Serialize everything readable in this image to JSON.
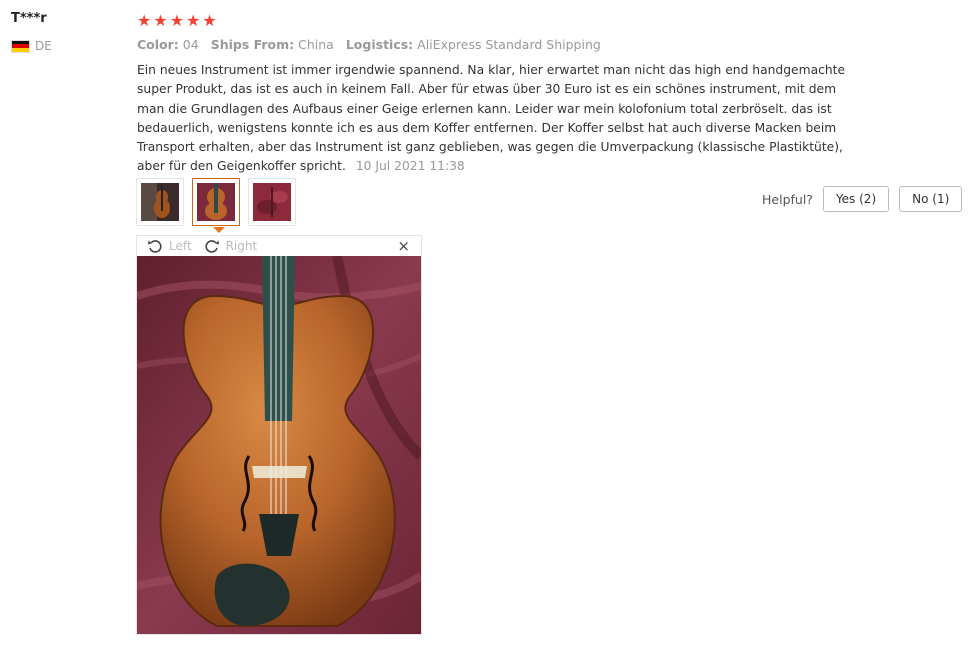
{
  "review": {
    "user": "T***r",
    "country": "DE",
    "rating": 5,
    "color_key": "Color:",
    "color_val": "04",
    "ships_key": "Ships From:",
    "ships_val": "China",
    "logistics_key": "Logistics:",
    "logistics_val": "AliExpress Standard Shipping",
    "text": "Ein neues Instrument ist immer irgendwie spannend. Na klar, hier erwartet man nicht das high end handgemachte super Produkt, das ist es auch in keinem Fall. Aber für etwas über 30 Euro ist es ein schönes instrument, mit dem man die Grundlagen des Aufbaus einer Geige erlernen kann. Leider war mein kolofonium total zerbröselt. das ist bedauerlich, wenigstens konnte ich es aus dem Koffer entfernen. Der Koffer selbst hat auch diverse Macken beim Transport erhalten, aber das Instrument ist ganz geblieben, was gegen die Umverpackung (klassische Plastiktüte), aber für den Geigenkoffer spricht.",
    "date": "10 Jul 2021 11:38"
  },
  "helpful": {
    "label": "Helpful?",
    "yes": "Yes (2)",
    "no": "No (1)"
  },
  "viewer": {
    "rotate_left": "Left",
    "rotate_right": "Right",
    "close": "×"
  },
  "colors": {
    "star": "#f44336",
    "active_thumb": "#c96a1b",
    "meta": "#999999"
  }
}
